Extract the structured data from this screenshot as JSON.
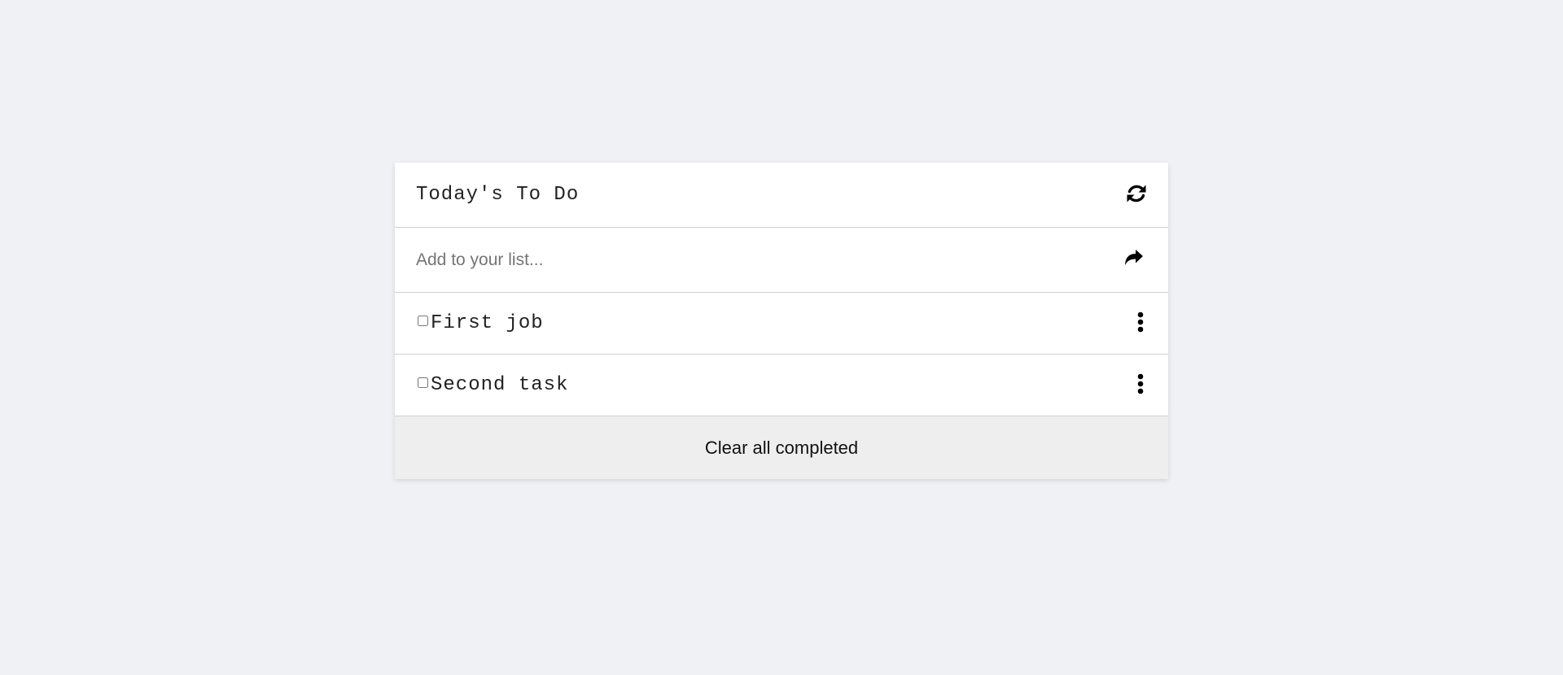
{
  "header": {
    "title": "Today's To Do",
    "refresh_icon": "refresh-icon"
  },
  "add_form": {
    "placeholder": "Add to your list...",
    "value": "",
    "submit_icon": "share-arrow-icon"
  },
  "tasks": [
    {
      "label": "First job",
      "completed": false,
      "menu_icon": "vertical-ellipsis-icon"
    },
    {
      "label": "Second task",
      "completed": false,
      "menu_icon": "vertical-ellipsis-icon"
    }
  ],
  "footer": {
    "clear_label": "Clear all completed"
  },
  "colors": {
    "page_background": "#f0f1f5",
    "card_background": "#ffffff",
    "footer_background": "#eeeeee",
    "divider": "#cfcfcf"
  }
}
